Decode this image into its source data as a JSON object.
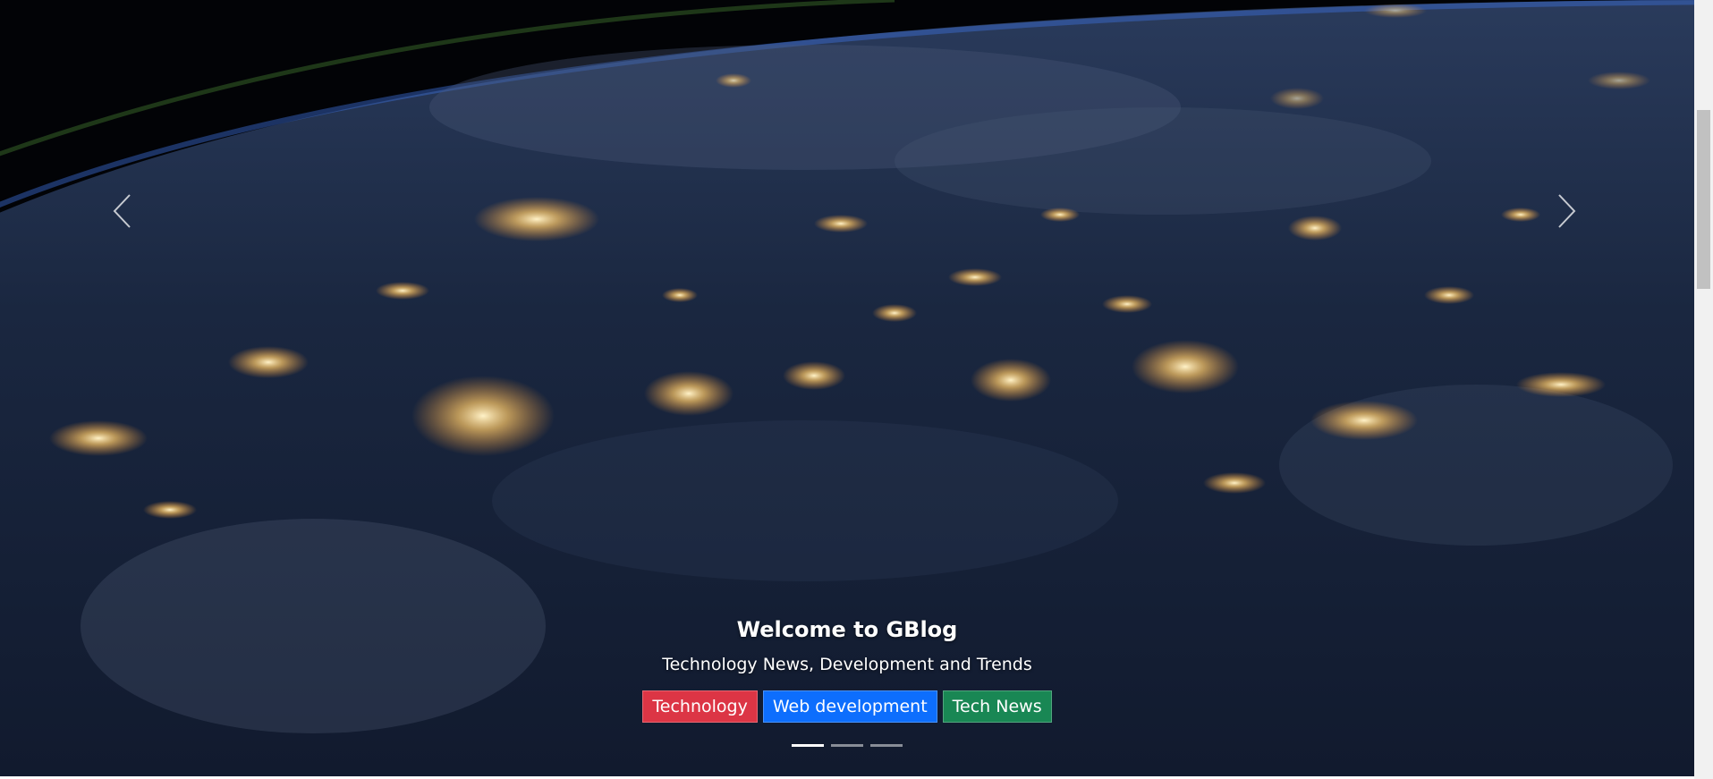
{
  "hero": {
    "title": "Welcome to GBlog",
    "subtitle": "Technology News, Development and Trends",
    "tags": [
      {
        "label": "Technology",
        "color": "#dc3545"
      },
      {
        "label": "Web development",
        "color": "#0d6efd"
      },
      {
        "label": "Tech News",
        "color": "#198754"
      }
    ],
    "active_slide": 1,
    "slide_count": 3
  },
  "icons": {
    "prev": "chevron-left-icon",
    "next": "chevron-right-icon"
  }
}
